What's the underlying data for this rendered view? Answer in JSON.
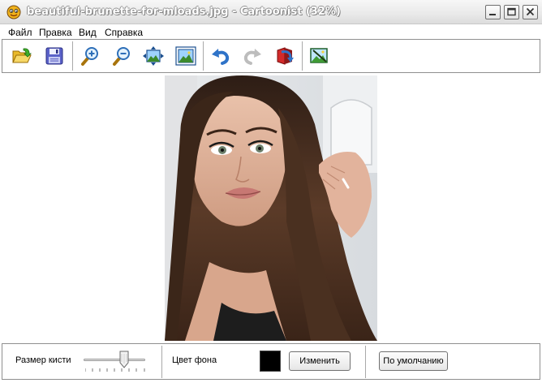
{
  "window": {
    "title": "beautiful-brunette-for-mloads.jpg - Cartoonist (32%)",
    "app_icon": "cartoonist-app-icon",
    "controls": [
      "minimize-icon",
      "maximize-icon",
      "close-icon"
    ]
  },
  "menu": {
    "items": [
      "Файл",
      "Правка",
      "Вид",
      "Справка"
    ]
  },
  "toolbar": {
    "buttons": [
      {
        "name": "open-button",
        "icon": "folder-open-icon"
      },
      {
        "name": "save-button",
        "icon": "floppy-save-icon"
      },
      {
        "name": "zoom-in-button",
        "icon": "zoom-in-icon"
      },
      {
        "name": "zoom-out-button",
        "icon": "zoom-out-icon"
      },
      {
        "name": "fit-window-button",
        "icon": "fit-to-window-icon"
      },
      {
        "name": "actual-size-button",
        "icon": "actual-size-icon"
      },
      {
        "name": "undo-button",
        "icon": "undo-arrow-icon"
      },
      {
        "name": "redo-button",
        "icon": "redo-arrow-icon"
      },
      {
        "name": "reset-button",
        "icon": "revert-icon"
      },
      {
        "name": "cartoonize-button",
        "icon": "cartoonize-picture-icon"
      }
    ]
  },
  "image": {
    "alt": "portrait photo"
  },
  "bottom": {
    "brush_size_label": "Размер кисти",
    "brush_size_level": 0.67,
    "bg_color_label": "Цвет фона",
    "bg_color": "#000000",
    "change_button": "Изменить",
    "default_button": "По умолчанию"
  }
}
